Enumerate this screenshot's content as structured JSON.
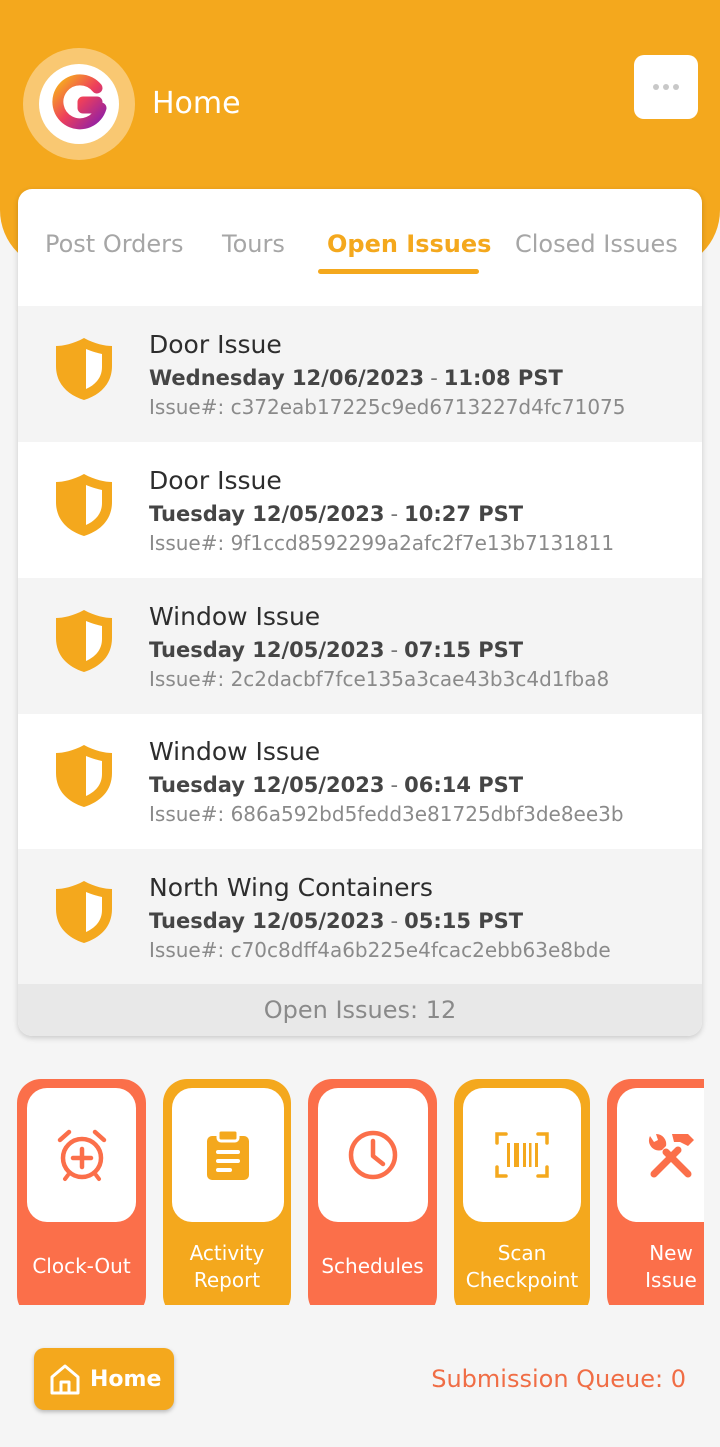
{
  "header": {
    "title": "Home",
    "brand_letter": "G"
  },
  "tabs": [
    {
      "label": "Post Orders",
      "active": false
    },
    {
      "label": "Tours",
      "active": false
    },
    {
      "label": "Open Issues",
      "active": true
    },
    {
      "label": "Closed Issues",
      "active": false
    }
  ],
  "issues": [
    {
      "title": "Door Issue",
      "day_date": "Wednesday 12/06/2023",
      "sep": "-",
      "time": "11:08 PST",
      "issue_no": "Issue#: c372eab17225c9ed6713227d4fc71075"
    },
    {
      "title": "Door Issue",
      "day_date": "Tuesday 12/05/2023",
      "sep": "-",
      "time": "10:27 PST",
      "issue_no": "Issue#: 9f1ccd8592299a2afc2f7e13b7131811"
    },
    {
      "title": "Window Issue",
      "day_date": "Tuesday 12/05/2023",
      "sep": "-",
      "time": "07:15 PST",
      "issue_no": "Issue#: 2c2dacbf7fce135a3cae43b3c4d1fba8"
    },
    {
      "title": "Window Issue",
      "day_date": "Tuesday 12/05/2023",
      "sep": "-",
      "time": "06:14 PST",
      "issue_no": "Issue#: 686a592bd5fedd3e81725dbf3de8ee3b"
    },
    {
      "title": "North Wing Containers",
      "day_date": "Tuesday 12/05/2023",
      "sep": "-",
      "time": "05:15 PST",
      "issue_no": "Issue#: c70c8dff4a6b225e4fcac2ebb63e8bde"
    }
  ],
  "open_issues_count": "Open Issues: 12",
  "actions": [
    {
      "line1": "Clock-Out",
      "line2": "",
      "icon": "alarm-clock-plus-icon"
    },
    {
      "line1": "Activity",
      "line2": "Report",
      "icon": "clipboard-icon"
    },
    {
      "line1": "Schedules",
      "line2": "",
      "icon": "clock-icon"
    },
    {
      "line1": "Scan",
      "line2": "Checkpoint",
      "icon": "barcode-icon"
    },
    {
      "line1": "New",
      "line2": "Issue",
      "icon": "tools-icon"
    }
  ],
  "bottom": {
    "home_label": "Home",
    "queue": "Submission Queue: 0"
  },
  "colors": {
    "primary": "#f4a81d",
    "accent": "#fb6f4a",
    "queue_text": "#f06d45"
  }
}
